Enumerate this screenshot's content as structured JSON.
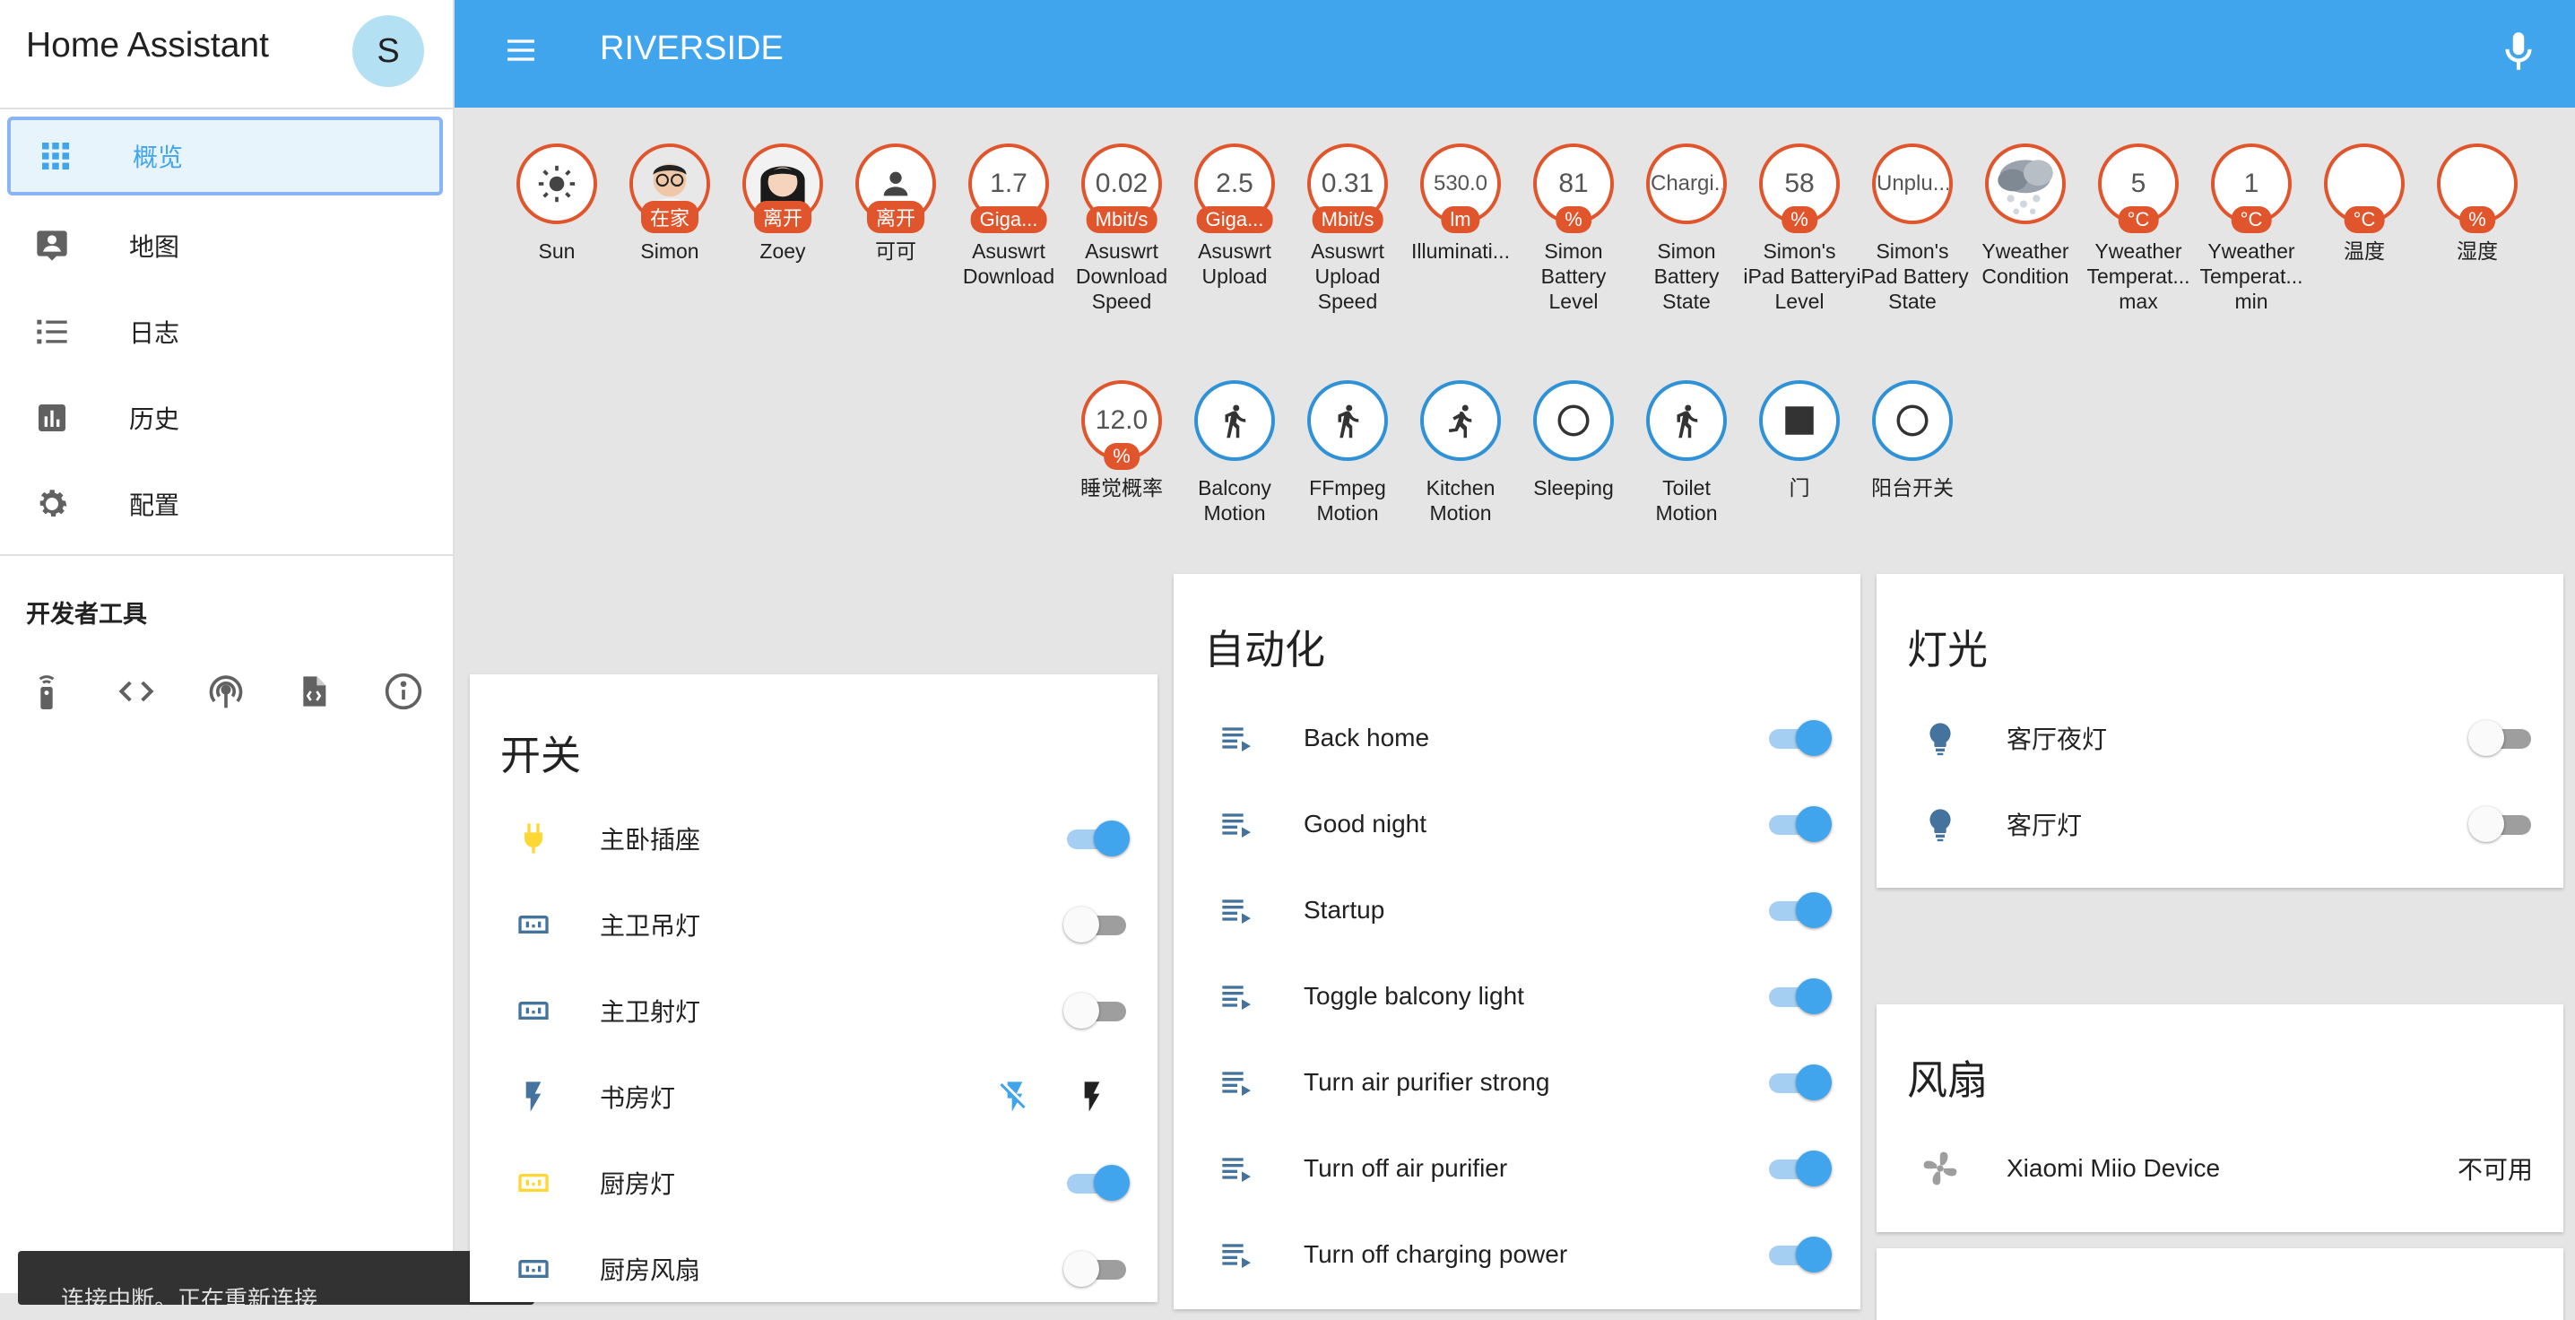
{
  "sidebar": {
    "brand": "Home Assistant",
    "avatar_initial": "S",
    "items": [
      {
        "label": "概览",
        "icon": "grid-icon"
      },
      {
        "label": "地图",
        "icon": "map-pin-icon"
      },
      {
        "label": "日志",
        "icon": "list-icon"
      },
      {
        "label": "历史",
        "icon": "chart-icon"
      },
      {
        "label": "配置",
        "icon": "gear-icon"
      }
    ],
    "dev_tools_title": "开发者工具",
    "dev_tools": [
      "remote-icon",
      "code-icon",
      "broadcast-icon",
      "file-code-icon",
      "info-icon"
    ]
  },
  "toast": "连接中断。正在重新连接...",
  "header": {
    "title": "RIVERSIDE",
    "menu_icon": "menu-icon",
    "mic_icon": "microphone-icon"
  },
  "badges_row1": [
    {
      "value": "",
      "unit": "",
      "name": "Sun",
      "icon": "sun-icon"
    },
    {
      "value": "",
      "unit": "在家",
      "name": "Simon",
      "icon": "person-photo-simon"
    },
    {
      "value": "",
      "unit": "离开",
      "name": "Zoey",
      "icon": "person-photo-zoey"
    },
    {
      "value": "",
      "unit": "离开",
      "name": "可可",
      "icon": "person-icon"
    },
    {
      "value": "1.7",
      "unit": "Giga...",
      "name": "Asuswrt Download"
    },
    {
      "value": "0.02",
      "unit": "Mbit/s",
      "name": "Asuswrt Download Speed"
    },
    {
      "value": "2.5",
      "unit": "Giga...",
      "name": "Asuswrt Upload"
    },
    {
      "value": "0.31",
      "unit": "Mbit/s",
      "name": "Asuswrt Upload Speed"
    },
    {
      "value": "530.0",
      "unit": "lm",
      "name": "Illuminati..."
    },
    {
      "value": "81",
      "unit": "%",
      "name": "Simon Battery Level"
    },
    {
      "value": "Chargi...",
      "unit": "",
      "name": "Simon Battery State"
    },
    {
      "value": "58",
      "unit": "%",
      "name": "Simon's iPad Battery Level"
    },
    {
      "value": "Unplu...",
      "unit": "",
      "name": "Simon's iPad Battery State"
    },
    {
      "value": "",
      "unit": "",
      "name": "Yweather Condition",
      "icon": "cloud-hail-icon"
    },
    {
      "value": "5",
      "unit": "°C",
      "name": "Yweather Temperat... max"
    },
    {
      "value": "1",
      "unit": "°C",
      "name": "Yweather Temperat... min"
    },
    {
      "value": "",
      "unit": "°C",
      "name": "温度"
    },
    {
      "value": "",
      "unit": "%",
      "name": "湿度"
    }
  ],
  "badges_row2": [
    {
      "value": "12.0",
      "unit": "%",
      "name": "睡觉概率"
    },
    {
      "name": "Balcony Motion",
      "icon": "walk-icon"
    },
    {
      "name": "FFmpeg Motion",
      "icon": "walk-icon"
    },
    {
      "name": "Kitchen Motion",
      "icon": "run-icon"
    },
    {
      "name": "Sleeping",
      "icon": "circle-outline-icon"
    },
    {
      "name": "Toilet Motion",
      "icon": "walk-icon"
    },
    {
      "name": "门",
      "icon": "square-icon"
    },
    {
      "name": "阳台开关",
      "icon": "circle-outline-icon"
    }
  ],
  "switch_card": {
    "title": "开关",
    "rows": [
      {
        "label": "主卧插座",
        "icon": "power-plug-icon",
        "state": "on"
      },
      {
        "label": "主卫吊灯",
        "icon": "outlet-icon",
        "state": "off"
      },
      {
        "label": "主卫射灯",
        "icon": "outlet-icon",
        "state": "off"
      },
      {
        "label": "书房灯",
        "icon": "flash-icon",
        "state": "buttons"
      },
      {
        "label": "厨房灯",
        "icon": "outlet-icon",
        "state": "on"
      },
      {
        "label": "厨房风扇",
        "icon": "outlet-icon",
        "state": "off"
      }
    ]
  },
  "automation_card": {
    "title": "自动化",
    "rows": [
      {
        "label": "Back home",
        "state": "on"
      },
      {
        "label": "Good night",
        "state": "on"
      },
      {
        "label": "Startup",
        "state": "on"
      },
      {
        "label": "Toggle balcony light",
        "state": "on"
      },
      {
        "label": "Turn air purifier strong",
        "state": "on"
      },
      {
        "label": "Turn off air purifier",
        "state": "on"
      },
      {
        "label": "Turn off charging power",
        "state": "on"
      }
    ]
  },
  "light_card": {
    "title": "灯光",
    "rows": [
      {
        "label": "客厅夜灯",
        "state": "off"
      },
      {
        "label": "客厅灯",
        "state": "off"
      }
    ]
  },
  "fan_card": {
    "title": "风扇",
    "rows": [
      {
        "label": "Xiaomi Miio Device",
        "status": "不可用"
      }
    ]
  },
  "colors": {
    "primary": "#41a5ee",
    "badge_border": "#e0552b",
    "icon_blue": "#44739e",
    "icon_yellow": "#fdd835"
  }
}
